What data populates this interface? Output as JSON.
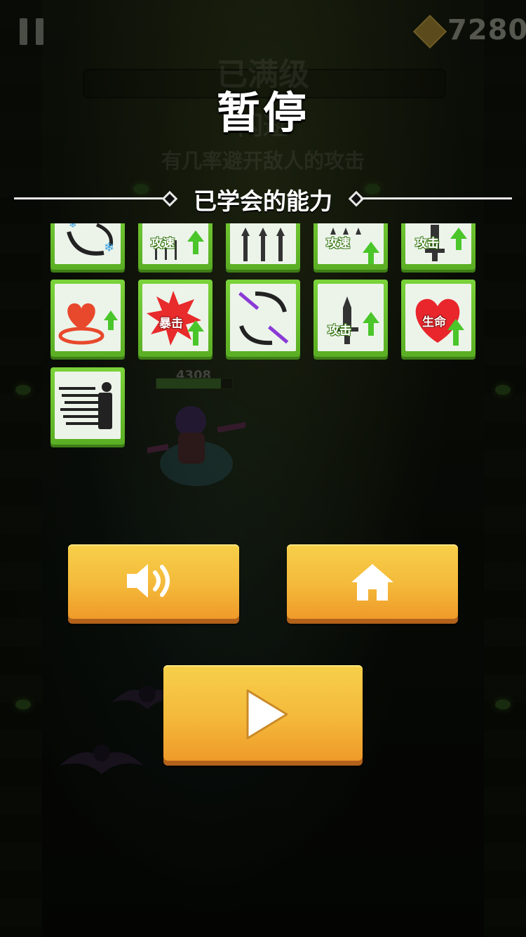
{
  "hud": {
    "gem_count": "7280",
    "gem_icon": "diamond-gem-icon",
    "pause_icon": "pause-icon"
  },
  "background": {
    "ghost_heading": "已满级",
    "ghost_item_name": "闪避",
    "ghost_description": "有几率避开敌人的攻击",
    "enemy_hp": "4308",
    "enemy_hp_fraction": 0.85
  },
  "pause_menu": {
    "title": "暂停",
    "section_title": "已学会的能力",
    "abilities_row1_partial": [
      {
        "icon": "frost-arc-icon",
        "label": ""
      },
      {
        "icon": "attack-speed-up-icon",
        "label": "攻速"
      },
      {
        "icon": "multishot-arrows-icon",
        "label": ""
      },
      {
        "icon": "attack-speed-up-icon",
        "label": "攻速"
      },
      {
        "icon": "attack-up-icon",
        "label": "攻击"
      }
    ],
    "abilities_row2": [
      {
        "icon": "heart-ring-up-icon",
        "label": ""
      },
      {
        "icon": "critical-up-icon",
        "label": "暴击"
      },
      {
        "icon": "spinning-blades-icon",
        "label": ""
      },
      {
        "icon": "attack-up-icon",
        "label": "攻击"
      },
      {
        "icon": "max-hp-up-icon",
        "label": "生命"
      }
    ],
    "abilities_row3": [
      {
        "icon": "speed-dash-icon",
        "label": ""
      }
    ],
    "buttons": {
      "sound_icon": "speaker-sound-icon",
      "home_icon": "home-icon",
      "resume_icon": "play-icon"
    }
  }
}
